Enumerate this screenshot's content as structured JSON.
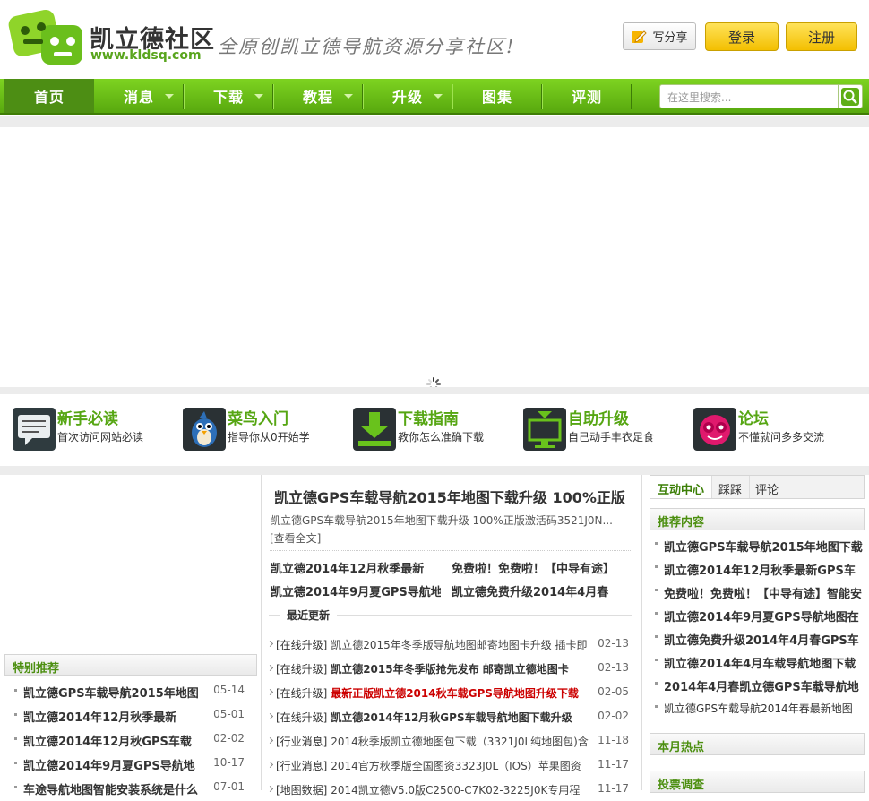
{
  "header": {
    "site_name": "凯立德社区",
    "site_url": "www.kldsq.com",
    "slogan": "全原创凯立德导航资源分享社区!",
    "share_label": "写分享",
    "login_label": "登录",
    "register_label": "注册"
  },
  "nav": {
    "items": [
      {
        "label": "首页",
        "active": true
      },
      {
        "label": "消息",
        "has_menu": true
      },
      {
        "label": "下载",
        "has_menu": true
      },
      {
        "label": "教程",
        "has_menu": true
      },
      {
        "label": "升级",
        "has_menu": true
      },
      {
        "label": "图集"
      },
      {
        "label": "评测"
      }
    ],
    "search_placeholder": "在这里搜索..."
  },
  "quick_links": [
    {
      "title": "新手必读",
      "sub": "首次访问网站必读",
      "icon": "message-board-icon"
    },
    {
      "title": "菜鸟入门",
      "sub": "指导你从0开始学",
      "icon": "bird-icon"
    },
    {
      "title": "下载指南",
      "sub": "教你怎么准确下载",
      "icon": "download-icon"
    },
    {
      "title": "自助升级",
      "sub": "自己动手丰衣足食",
      "icon": "upgrade-icon"
    },
    {
      "title": "论坛",
      "sub": "不懂就问多多交流",
      "icon": "forum-icon"
    }
  ],
  "special": {
    "title": "特别推荐",
    "items": [
      {
        "title": "凯立德GPS车载导航2015年地图",
        "date": "05-14"
      },
      {
        "title": "凯立德2014年12月秋季最新",
        "date": "05-01"
      },
      {
        "title": "凯立德2014年12月秋GPS车载",
        "date": "02-02"
      },
      {
        "title": "凯立德2014年9月夏GPS导航地",
        "date": "10-17"
      },
      {
        "title": "车途导航地图智能安装系统是什么",
        "date": "07-01"
      }
    ]
  },
  "featured": {
    "headline": "凯立德GPS车载导航2015年地图下载升级 100%正版",
    "summary": "凯立德GPS车载导航2015年地图下载升级 100%正版激活码3521J0N...",
    "read_more": "[查看全文]",
    "hot": [
      "凯立德2014年12月秋季最新",
      "免费啦！免费啦！【中导有途】",
      "凯立德2014年9月夏GPS导航地",
      "凯立德免费升级2014年4月春"
    ],
    "recent_title": "最近更新",
    "recent": [
      {
        "cat": "[在线升级]",
        "title": "凯立德2015年冬季版导航地图邮寄地图卡升级 插卡即",
        "date": "02-13",
        "style": "normal"
      },
      {
        "cat": "[在线升级]",
        "title": "凯立德2015年冬季版抢先发布  邮寄凯立德地图卡",
        "date": "02-13",
        "style": "bold"
      },
      {
        "cat": "[在线升级]",
        "title": "最新正版凯立德2014秋车载GPS导航地图升级下载",
        "date": "02-05",
        "style": "red"
      },
      {
        "cat": "[在线升级]",
        "title": "凯立德2014年12月秋GPS车载导航地图下载升级",
        "date": "02-02",
        "style": "bold"
      },
      {
        "cat": "[行业消息]",
        "title": "2014秋季版凯立德地图包下载（3321J0L纯地图包)含",
        "date": "11-18",
        "style": "normal"
      },
      {
        "cat": "[行业消息]",
        "title": "2014官方秋季版全国图资3323J0L（IOS）苹果图资",
        "date": "11-17",
        "style": "normal"
      },
      {
        "cat": "[地图数据]",
        "title": "2014凯立德V5.0版C2500-C7K02-3225J0K专用程",
        "date": "11-17",
        "style": "normal"
      }
    ]
  },
  "right": {
    "tabs": [
      "互动中心",
      "踩踩",
      "评论"
    ],
    "recommend_title": "推荐内容",
    "recommend": [
      {
        "title": "凯立德GPS车载导航2015年地图下载",
        "bold": true
      },
      {
        "title": "凯立德2014年12月秋季最新GPS车",
        "bold": true
      },
      {
        "title": "免费啦！免费啦！【中导有途】智能安",
        "bold": true
      },
      {
        "title": "凯立德2014年9月夏GPS导航地图在",
        "bold": true
      },
      {
        "title": "凯立德免费升级2014年4月春GPS车",
        "bold": true
      },
      {
        "title": "凯立德2014年4月车载导航地图下载",
        "bold": true
      },
      {
        "title": "2014年4月春凯立德GPS车载导航地",
        "bold": true
      },
      {
        "title": "凯立德GPS车载导航2014年春最新地图",
        "bold": false
      }
    ],
    "hot_title": "本月热点",
    "vote_title": "投票调查"
  },
  "colors": {
    "brand_green": "#58a80e",
    "nav_active": "#4d8e14",
    "button_yellow": "#f3bf00",
    "highlight_red": "#cc0000"
  }
}
